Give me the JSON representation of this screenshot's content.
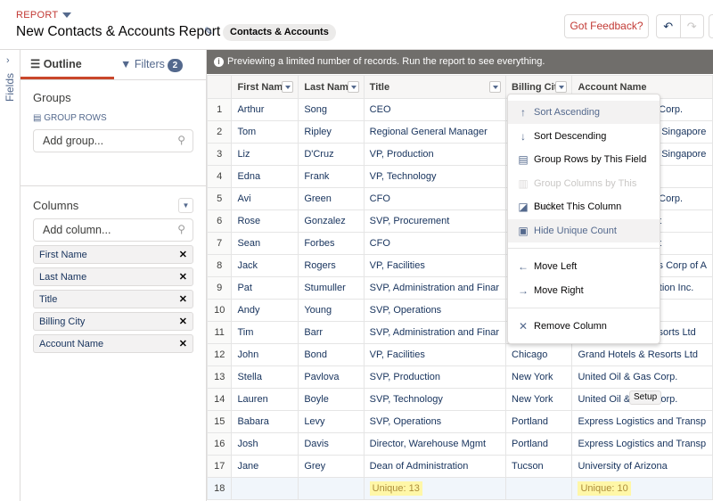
{
  "header": {
    "report_label": "REPORT",
    "title": "New Contacts & Accounts Report",
    "report_type": "Contacts & Accounts",
    "feedback": "Got Feedback?",
    "undo_icon": "↶",
    "redo_icon": "↷"
  },
  "fields_tab": {
    "label": "Fields",
    "chevron": "›"
  },
  "panel": {
    "tabs": {
      "outline": "Outline",
      "filters": "Filters",
      "filter_count": "2"
    },
    "groups": {
      "title": "Groups",
      "group_rows": "GROUP ROWS",
      "placeholder": "Add group..."
    },
    "columns": {
      "title": "Columns",
      "placeholder": "Add column...",
      "items": [
        "First Name",
        "Last Name",
        "Title",
        "Billing City",
        "Account Name"
      ]
    }
  },
  "grid": {
    "info": "Previewing a limited number of records. Run the report to see everything.",
    "headers": [
      "First Name",
      "Last Name",
      "Title",
      "Billing City",
      "Account Name"
    ],
    "rows": [
      [
        "1",
        "Arthur",
        "Song",
        "CEO",
        "",
        "as Corp."
      ],
      [
        "2",
        "Tom",
        "Ripley",
        "Regional General Manager",
        "",
        "as, Singapore"
      ],
      [
        "3",
        "Liz",
        "D'Cruz",
        "VP, Production",
        "",
        "as, Singapore"
      ],
      [
        "4",
        "Edna",
        "Frank",
        "VP, Technology",
        "",
        ""
      ],
      [
        "5",
        "Avi",
        "Green",
        "CFO",
        "",
        "as Corp."
      ],
      [
        "6",
        "Rose",
        "Gonzalez",
        "SVP, Procurement",
        "",
        "test"
      ],
      [
        "7",
        "Sean",
        "Forbes",
        "CFO",
        "",
        "test"
      ],
      [
        "8",
        "Jack",
        "Rogers",
        "VP, Facilities",
        "",
        "tiles Corp of A"
      ],
      [
        "9",
        "Pat",
        "Stumuller",
        "SVP, Administration and Finar",
        "",
        "ruction Inc."
      ],
      [
        "10",
        "Andy",
        "Young",
        "SVP, Operations",
        "",
        ""
      ],
      [
        "11",
        "Tim",
        "Barr",
        "SVP, Administration and Finar",
        "",
        "Resorts Ltd"
      ],
      [
        "12",
        "John",
        "Bond",
        "VP, Facilities",
        "Chicago",
        "Grand Hotels & Resorts Ltd"
      ],
      [
        "13",
        "Stella",
        "Pavlova",
        "SVP, Production",
        "New York",
        "United Oil & Gas Corp."
      ],
      [
        "14",
        "Lauren",
        "Boyle",
        "SVP, Technology",
        "New York",
        "United Oil & Gas Corp."
      ],
      [
        "15",
        "Babara",
        "Levy",
        "SVP, Operations",
        "Portland",
        "Express Logistics and Transp"
      ],
      [
        "16",
        "Josh",
        "Davis",
        "Director, Warehouse Mgmt",
        "Portland",
        "Express Logistics and Transp"
      ],
      [
        "17",
        "Jane",
        "Grey",
        "Dean of Administration",
        "Tucson",
        "University of Arizona"
      ]
    ],
    "summary": {
      "row": "18",
      "title_unique": "Unique: 13",
      "account_unique": "Unique: 10"
    }
  },
  "menu": {
    "items": [
      {
        "label": "Sort Ascending",
        "icon": "arrow-up",
        "glyph": "↑",
        "state": "hover"
      },
      {
        "label": "Sort Descending",
        "icon": "arrow-down",
        "glyph": "↓"
      },
      {
        "label": "Group Rows by This Field",
        "icon": "group-rows",
        "glyph": "▤"
      },
      {
        "label": "Group Columns by This Field",
        "icon": "group-columns",
        "glyph": "▥",
        "state": "disabled"
      },
      {
        "label": "Bucket This Column",
        "icon": "bucket",
        "glyph": "◪"
      },
      {
        "label": "Hide Unique Count",
        "icon": "unique-count",
        "glyph": "▣",
        "state": "hover"
      },
      {
        "label": "Move Left",
        "icon": "arrow-left",
        "glyph": "←"
      },
      {
        "label": "Move Right",
        "icon": "arrow-right",
        "glyph": "→"
      },
      {
        "label": "Remove Column",
        "icon": "close",
        "glyph": "✕"
      }
    ]
  },
  "tooltip": "Setup",
  "colors": {
    "accent": "#c9472b",
    "text": "#16325c",
    "info_bar": "#706e6b",
    "highlight": "#fff7a8"
  }
}
